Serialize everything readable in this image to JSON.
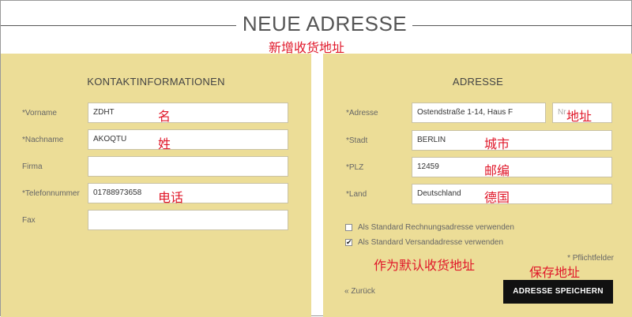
{
  "page": {
    "title": "NEUE ADRESSE"
  },
  "annotations": {
    "title": "新增收货地址",
    "first_name": "名",
    "last_name": "姓",
    "phone": "电话",
    "address": "地址",
    "city": "城市",
    "zip": "邮编",
    "country": "德国",
    "default": "作为默认收货地址",
    "save": "保存地址",
    "color": "#e0182a"
  },
  "contact": {
    "heading": "KONTAKTINFORMATIONEN",
    "fields": [
      {
        "label": "*Vorname",
        "value": "ZDHT"
      },
      {
        "label": "*Nachname",
        "value": "AKOQTU"
      },
      {
        "label": "Firma",
        "value": ""
      },
      {
        "label": "*Telefonnummer",
        "value": "01788973658"
      },
      {
        "label": "Fax",
        "value": ""
      }
    ]
  },
  "address": {
    "heading": "ADRESSE",
    "street": {
      "label": "*Adresse",
      "value": "Ostendstraße 1-14, Haus F",
      "number_placeholder": "Nr"
    },
    "city": {
      "label": "*Stadt",
      "value": "BERLIN"
    },
    "zip": {
      "label": "*PLZ",
      "value": "12459"
    },
    "country": {
      "label": "*Land",
      "value": "Deutschland"
    },
    "checkboxes": [
      {
        "label": "Als Standard Rechnungsadresse verwenden",
        "checked": false
      },
      {
        "label": "Als Standard Versandadresse verwenden",
        "checked": true
      }
    ],
    "required_note": "* Pflichtfelder",
    "back_label": "« Zurück",
    "save_label": "ADRESSE SPEICHERN"
  },
  "colors": {
    "panel": "#ecdd97",
    "button": "#111111",
    "annotation": "#e0182a"
  }
}
